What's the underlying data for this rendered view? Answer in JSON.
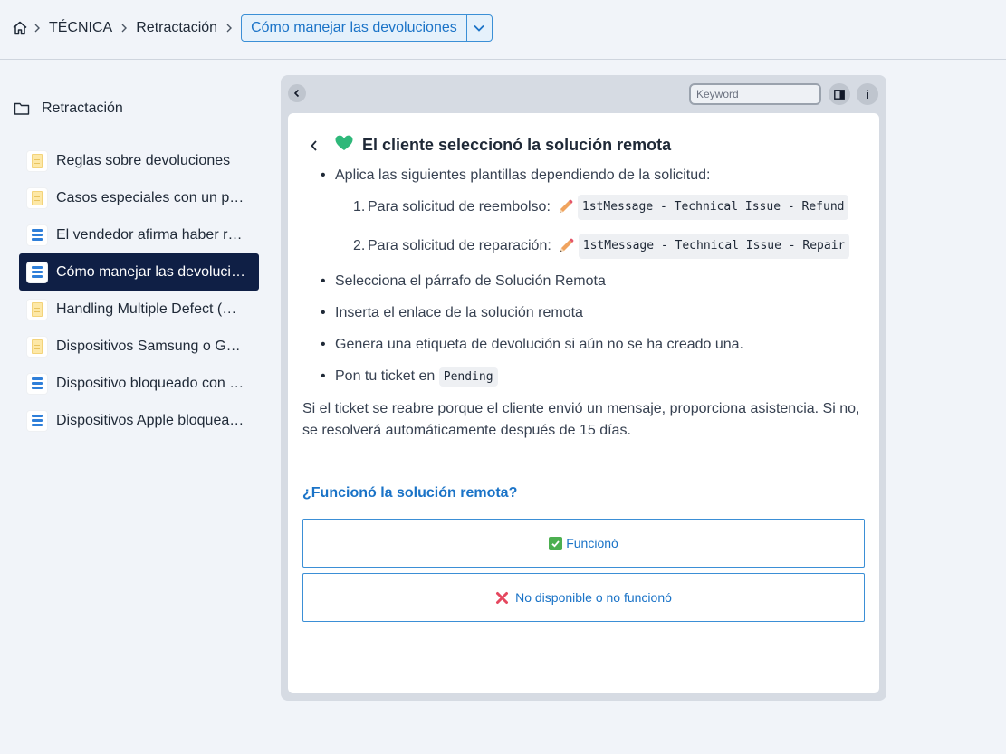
{
  "breadcrumb": {
    "items": [
      "TÉCNICA",
      "Retractación"
    ],
    "current": "Cómo manejar las devoluciones"
  },
  "sidebar": {
    "folder": "Retractación",
    "items": [
      {
        "label": "Reglas sobre devoluciones",
        "icon": "note"
      },
      {
        "label": "Casos especiales con un pro…",
        "icon": "note"
      },
      {
        "label": "El vendedor afirma haber re…",
        "icon": "flow"
      },
      {
        "label": "Cómo manejar las devolucio…",
        "icon": "flow",
        "active": true
      },
      {
        "label": "Handling Multiple Defect (D…",
        "icon": "note"
      },
      {
        "label": "Dispositivos Samsung o Goo…",
        "icon": "note"
      },
      {
        "label": "Dispositivo bloqueado con p…",
        "icon": "flow"
      },
      {
        "label": "Dispositivos Apple bloquea…",
        "icon": "flow"
      }
    ]
  },
  "toolbar": {
    "keyword_placeholder": "Keyword",
    "info_label": "i"
  },
  "card": {
    "title": "El cliente seleccionó la solución remota",
    "bullet_1": "Aplica las siguientes plantillas dependiendo de la solicitud:",
    "sub_1_num": "1.",
    "sub_1_text": "Para solicitud de reembolso:",
    "sub_1_code": "1stMessage - Technical Issue - Refund",
    "sub_2_num": "2.",
    "sub_2_text": "Para solicitud de reparación:",
    "sub_2_code": "1stMessage - Technical Issue - Repair",
    "bullet_2": "Selecciona el párrafo de Solución Remota",
    "bullet_3": "Inserta el enlace de la solución remota",
    "bullet_4": "Genera una etiqueta de devolución si aún no se ha creado una.",
    "bullet_5_text": "Pon tu ticket en",
    "bullet_5_code": "Pending",
    "paragraph": "Si el ticket se reabre porque el cliente envió un mensaje, proporciona asistencia. Si no, se resolverá automáticamente después de 15 días.",
    "question": "¿Funcionó la solución remota?",
    "choice_yes": "Funcionó",
    "choice_no": "No disponible o no funcionó"
  },
  "colors": {
    "accent": "#1a73c7",
    "active_nav": "#0f1f45",
    "heart": "#2fb87a"
  }
}
